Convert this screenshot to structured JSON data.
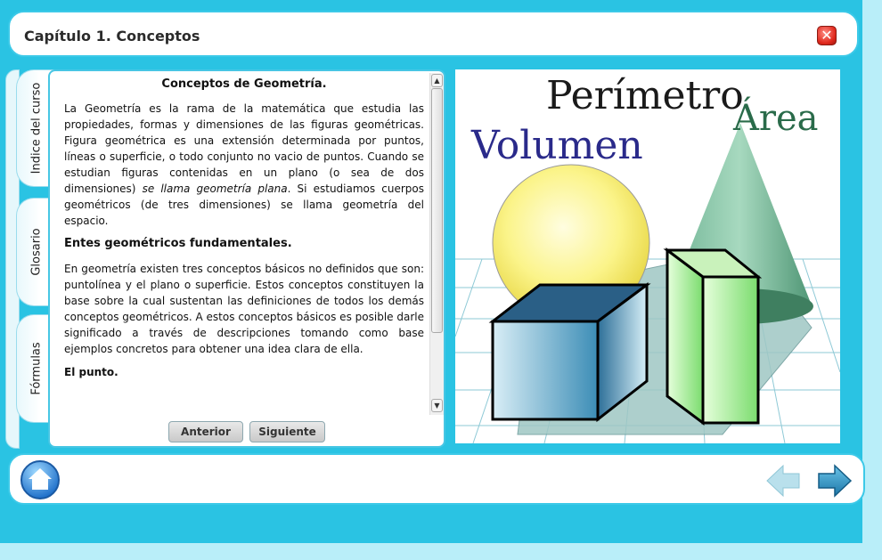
{
  "header": {
    "title": "Capítulo 1. Conceptos",
    "close_icon": "close-icon"
  },
  "side_tabs": [
    {
      "label": "Indice del curso"
    },
    {
      "label": "Glosario"
    },
    {
      "label": "Fórmulas"
    }
  ],
  "content": {
    "heading": "Conceptos de Geometría.",
    "para1": "La Geometría es la rama de la matemática que estudia las propiedades, formas y dimensiones de las figuras geométricas. Figura geométrica es una extensión determinada por puntos, líneas o superficie, o todo conjunto no vacio de puntos. Cuando se estudian figuras contenidas en un plano (o sea de dos dimensiones) ",
    "para1_italic": "se llama geometría plana",
    "para1_end": ". Si estudiamos cuerpos geométricos (de tres dimensiones) se llama geometría del espacio.",
    "subheading": "Entes geométricos fundamentales.",
    "para2": "En geometría existen tres conceptos básicos no definidos que son: puntolínea y el plano o superficie. Estos conceptos constituyen la base sobre la cual sustentan las definiciones de todos los demás conceptos geométricos. A estos conceptos básicos es posible darle significado a través de descripciones tomando como base ejemplos concretos para obtener una idea clara de ella.",
    "subheading2": "El punto."
  },
  "buttons": {
    "previous": "Anterior",
    "next": "Siguiente"
  },
  "illustration": {
    "word_perimeter": "Perímetro",
    "word_area": "Área",
    "word_volume": "Volumen"
  },
  "footer": {
    "home_icon": "home-icon",
    "back_icon": "arrow-left-icon",
    "forward_icon": "arrow-right-icon"
  },
  "colors": {
    "frame": "#2ac3e3",
    "background": "#b9eef9",
    "border": "#3cc9e8"
  }
}
